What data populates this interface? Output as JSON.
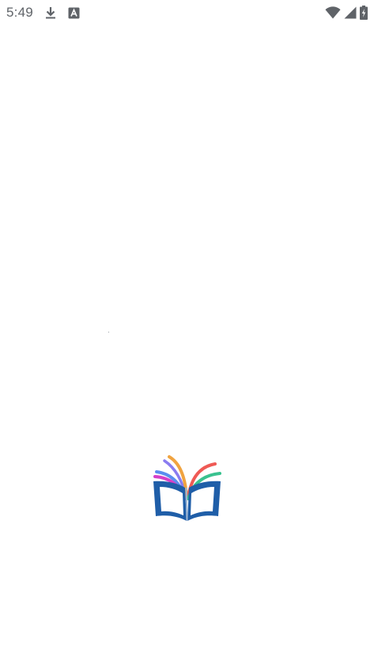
{
  "status_bar": {
    "time": "5:49",
    "icons": [
      "download-icon",
      "a-notification-icon",
      "wifi-icon",
      "cell-signal-icon",
      "battery-charging-icon"
    ]
  },
  "splash": {
    "logo_icon": "open-book-logo-icon",
    "colors": {
      "book": "#1f5ea8",
      "page_center": "#9fb8d6",
      "ribbon_blue": "#5b8def",
      "ribbon_magenta": "#d63fc8",
      "ribbon_orange": "#f0a340",
      "ribbon_red": "#ef5a55",
      "ribbon_green": "#39c28f"
    }
  }
}
